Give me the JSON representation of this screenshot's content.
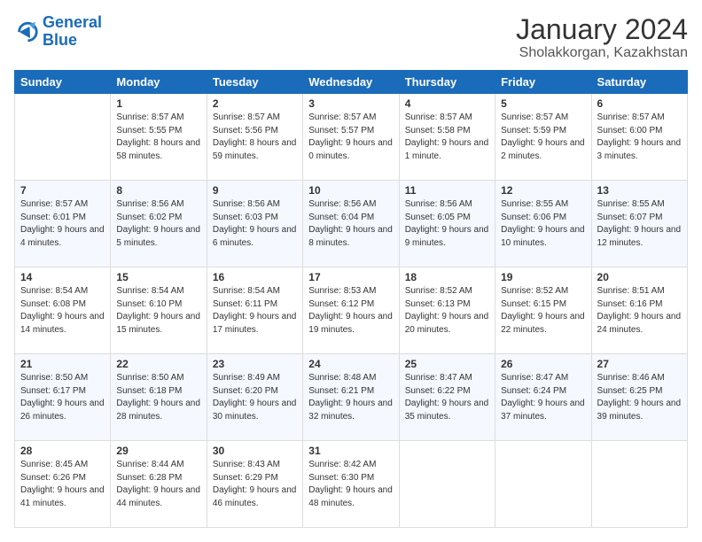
{
  "header": {
    "logo_general": "General",
    "logo_blue": "Blue",
    "title": "January 2024",
    "subtitle": "Sholakkorgan, Kazakhstan"
  },
  "days_of_week": [
    "Sunday",
    "Monday",
    "Tuesday",
    "Wednesday",
    "Thursday",
    "Friday",
    "Saturday"
  ],
  "weeks": [
    [
      {
        "day": "",
        "sunrise": "",
        "sunset": "",
        "daylight": ""
      },
      {
        "day": "1",
        "sunrise": "Sunrise: 8:57 AM",
        "sunset": "Sunset: 5:55 PM",
        "daylight": "Daylight: 8 hours and 58 minutes."
      },
      {
        "day": "2",
        "sunrise": "Sunrise: 8:57 AM",
        "sunset": "Sunset: 5:56 PM",
        "daylight": "Daylight: 8 hours and 59 minutes."
      },
      {
        "day": "3",
        "sunrise": "Sunrise: 8:57 AM",
        "sunset": "Sunset: 5:57 PM",
        "daylight": "Daylight: 9 hours and 0 minutes."
      },
      {
        "day": "4",
        "sunrise": "Sunrise: 8:57 AM",
        "sunset": "Sunset: 5:58 PM",
        "daylight": "Daylight: 9 hours and 1 minute."
      },
      {
        "day": "5",
        "sunrise": "Sunrise: 8:57 AM",
        "sunset": "Sunset: 5:59 PM",
        "daylight": "Daylight: 9 hours and 2 minutes."
      },
      {
        "day": "6",
        "sunrise": "Sunrise: 8:57 AM",
        "sunset": "Sunset: 6:00 PM",
        "daylight": "Daylight: 9 hours and 3 minutes."
      }
    ],
    [
      {
        "day": "7",
        "sunrise": "Sunrise: 8:57 AM",
        "sunset": "Sunset: 6:01 PM",
        "daylight": "Daylight: 9 hours and 4 minutes."
      },
      {
        "day": "8",
        "sunrise": "Sunrise: 8:56 AM",
        "sunset": "Sunset: 6:02 PM",
        "daylight": "Daylight: 9 hours and 5 minutes."
      },
      {
        "day": "9",
        "sunrise": "Sunrise: 8:56 AM",
        "sunset": "Sunset: 6:03 PM",
        "daylight": "Daylight: 9 hours and 6 minutes."
      },
      {
        "day": "10",
        "sunrise": "Sunrise: 8:56 AM",
        "sunset": "Sunset: 6:04 PM",
        "daylight": "Daylight: 9 hours and 8 minutes."
      },
      {
        "day": "11",
        "sunrise": "Sunrise: 8:56 AM",
        "sunset": "Sunset: 6:05 PM",
        "daylight": "Daylight: 9 hours and 9 minutes."
      },
      {
        "day": "12",
        "sunrise": "Sunrise: 8:55 AM",
        "sunset": "Sunset: 6:06 PM",
        "daylight": "Daylight: 9 hours and 10 minutes."
      },
      {
        "day": "13",
        "sunrise": "Sunrise: 8:55 AM",
        "sunset": "Sunset: 6:07 PM",
        "daylight": "Daylight: 9 hours and 12 minutes."
      }
    ],
    [
      {
        "day": "14",
        "sunrise": "Sunrise: 8:54 AM",
        "sunset": "Sunset: 6:08 PM",
        "daylight": "Daylight: 9 hours and 14 minutes."
      },
      {
        "day": "15",
        "sunrise": "Sunrise: 8:54 AM",
        "sunset": "Sunset: 6:10 PM",
        "daylight": "Daylight: 9 hours and 15 minutes."
      },
      {
        "day": "16",
        "sunrise": "Sunrise: 8:54 AM",
        "sunset": "Sunset: 6:11 PM",
        "daylight": "Daylight: 9 hours and 17 minutes."
      },
      {
        "day": "17",
        "sunrise": "Sunrise: 8:53 AM",
        "sunset": "Sunset: 6:12 PM",
        "daylight": "Daylight: 9 hours and 19 minutes."
      },
      {
        "day": "18",
        "sunrise": "Sunrise: 8:52 AM",
        "sunset": "Sunset: 6:13 PM",
        "daylight": "Daylight: 9 hours and 20 minutes."
      },
      {
        "day": "19",
        "sunrise": "Sunrise: 8:52 AM",
        "sunset": "Sunset: 6:15 PM",
        "daylight": "Daylight: 9 hours and 22 minutes."
      },
      {
        "day": "20",
        "sunrise": "Sunrise: 8:51 AM",
        "sunset": "Sunset: 6:16 PM",
        "daylight": "Daylight: 9 hours and 24 minutes."
      }
    ],
    [
      {
        "day": "21",
        "sunrise": "Sunrise: 8:50 AM",
        "sunset": "Sunset: 6:17 PM",
        "daylight": "Daylight: 9 hours and 26 minutes."
      },
      {
        "day": "22",
        "sunrise": "Sunrise: 8:50 AM",
        "sunset": "Sunset: 6:18 PM",
        "daylight": "Daylight: 9 hours and 28 minutes."
      },
      {
        "day": "23",
        "sunrise": "Sunrise: 8:49 AM",
        "sunset": "Sunset: 6:20 PM",
        "daylight": "Daylight: 9 hours and 30 minutes."
      },
      {
        "day": "24",
        "sunrise": "Sunrise: 8:48 AM",
        "sunset": "Sunset: 6:21 PM",
        "daylight": "Daylight: 9 hours and 32 minutes."
      },
      {
        "day": "25",
        "sunrise": "Sunrise: 8:47 AM",
        "sunset": "Sunset: 6:22 PM",
        "daylight": "Daylight: 9 hours and 35 minutes."
      },
      {
        "day": "26",
        "sunrise": "Sunrise: 8:47 AM",
        "sunset": "Sunset: 6:24 PM",
        "daylight": "Daylight: 9 hours and 37 minutes."
      },
      {
        "day": "27",
        "sunrise": "Sunrise: 8:46 AM",
        "sunset": "Sunset: 6:25 PM",
        "daylight": "Daylight: 9 hours and 39 minutes."
      }
    ],
    [
      {
        "day": "28",
        "sunrise": "Sunrise: 8:45 AM",
        "sunset": "Sunset: 6:26 PM",
        "daylight": "Daylight: 9 hours and 41 minutes."
      },
      {
        "day": "29",
        "sunrise": "Sunrise: 8:44 AM",
        "sunset": "Sunset: 6:28 PM",
        "daylight": "Daylight: 9 hours and 44 minutes."
      },
      {
        "day": "30",
        "sunrise": "Sunrise: 8:43 AM",
        "sunset": "Sunset: 6:29 PM",
        "daylight": "Daylight: 9 hours and 46 minutes."
      },
      {
        "day": "31",
        "sunrise": "Sunrise: 8:42 AM",
        "sunset": "Sunset: 6:30 PM",
        "daylight": "Daylight: 9 hours and 48 minutes."
      },
      {
        "day": "",
        "sunrise": "",
        "sunset": "",
        "daylight": ""
      },
      {
        "day": "",
        "sunrise": "",
        "sunset": "",
        "daylight": ""
      },
      {
        "day": "",
        "sunrise": "",
        "sunset": "",
        "daylight": ""
      }
    ]
  ]
}
